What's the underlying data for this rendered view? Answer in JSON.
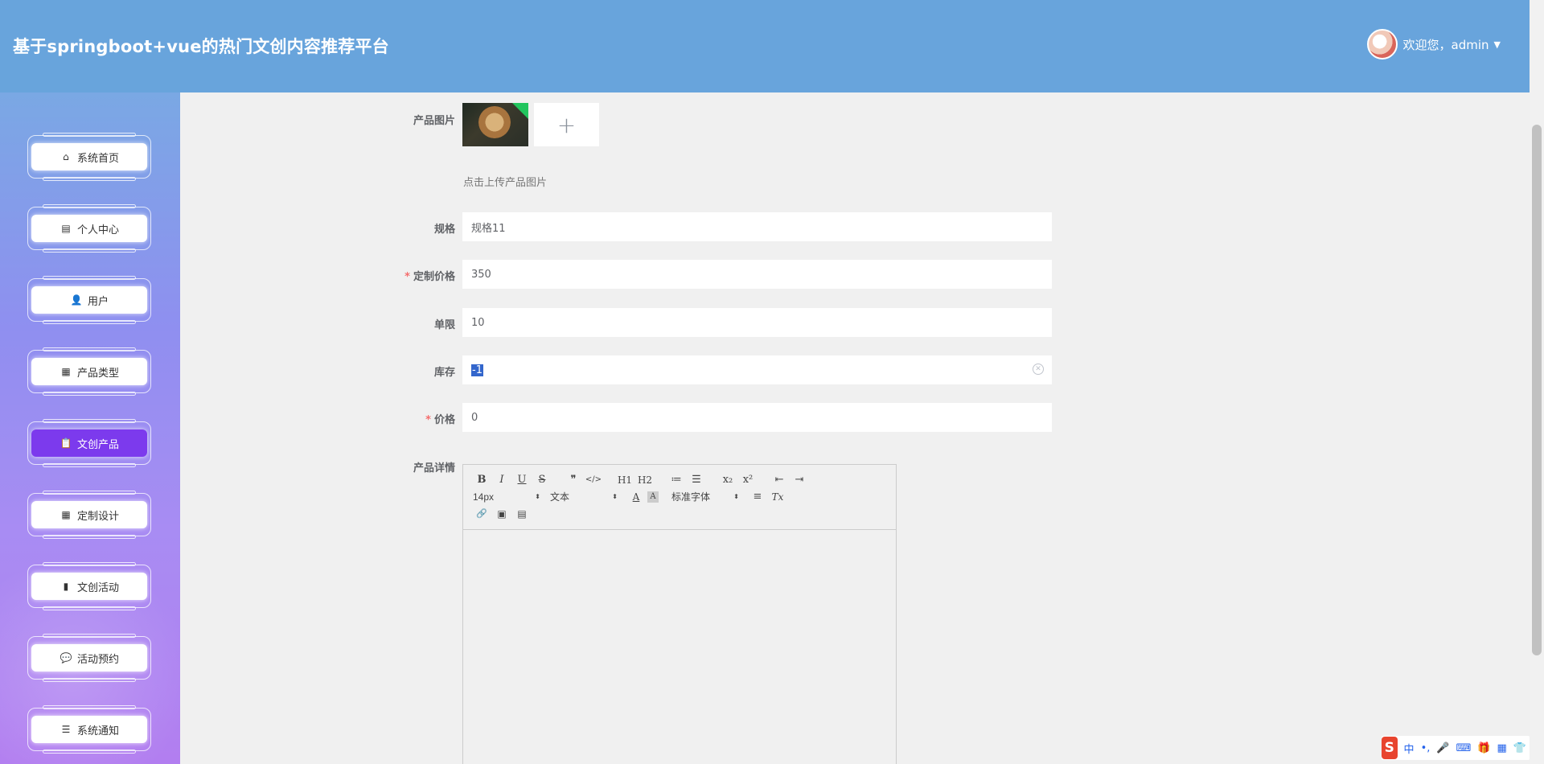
{
  "header": {
    "title": "基于springboot+vue的热门文创内容推荐平台",
    "user_greeting": "欢迎您，admin",
    "caret": "▼"
  },
  "sidebar": {
    "items": [
      {
        "label": "系统首页",
        "icon": "home-icon",
        "glyph": "⌂"
      },
      {
        "label": "个人中心",
        "icon": "wallet-icon",
        "glyph": "▤"
      },
      {
        "label": "用户",
        "icon": "user-icon",
        "glyph": "👤"
      },
      {
        "label": "产品类型",
        "icon": "grid-icon",
        "glyph": "▦"
      },
      {
        "label": "文创产品",
        "icon": "clipboard-icon",
        "glyph": "📋"
      },
      {
        "label": "定制设计",
        "icon": "grid-icon",
        "glyph": "▦"
      },
      {
        "label": "文创活动",
        "icon": "bar-chart-icon",
        "glyph": "▮"
      },
      {
        "label": "活动预约",
        "icon": "chat-icon",
        "glyph": "💬"
      },
      {
        "label": "系统通知",
        "icon": "list-icon",
        "glyph": "☰"
      }
    ],
    "active_index": 4
  },
  "form": {
    "image_label": "产品图片",
    "upload_plus": "+",
    "upload_tip": "点击上传产品图片",
    "spec_label": "规格",
    "spec_value": "规格11",
    "custom_price_label": "定制价格",
    "custom_price_value": "350",
    "limit_label": "单限",
    "limit_value": "10",
    "stock_label": "库存",
    "stock_value": "-1",
    "price_label": "价格",
    "price_value": "0",
    "detail_label": "产品详情",
    "required_mark": "*"
  },
  "editor": {
    "row1": [
      "B",
      "I",
      "U",
      "S",
      "❞",
      "</>",
      "H1",
      "H2",
      "≔",
      "☰",
      "x₂",
      "x²",
      "⇤",
      "⇥"
    ],
    "font_size": "14px",
    "header_picker": "文本",
    "font_picker": "标准字体",
    "picker_arrow": "⬍",
    "row2_icons": [
      "A",
      "A",
      "≡",
      "Tx"
    ],
    "row3": [
      "🔗",
      "▣",
      "▤"
    ]
  },
  "ime": {
    "logo": "S",
    "items": [
      "中",
      "•,",
      "🎤",
      "⌨",
      "🎁",
      "▦",
      "👕"
    ]
  },
  "colors": {
    "header_bg": "#68a4dc",
    "active_menu": "#7c3aed",
    "required": "#f56c6c"
  }
}
